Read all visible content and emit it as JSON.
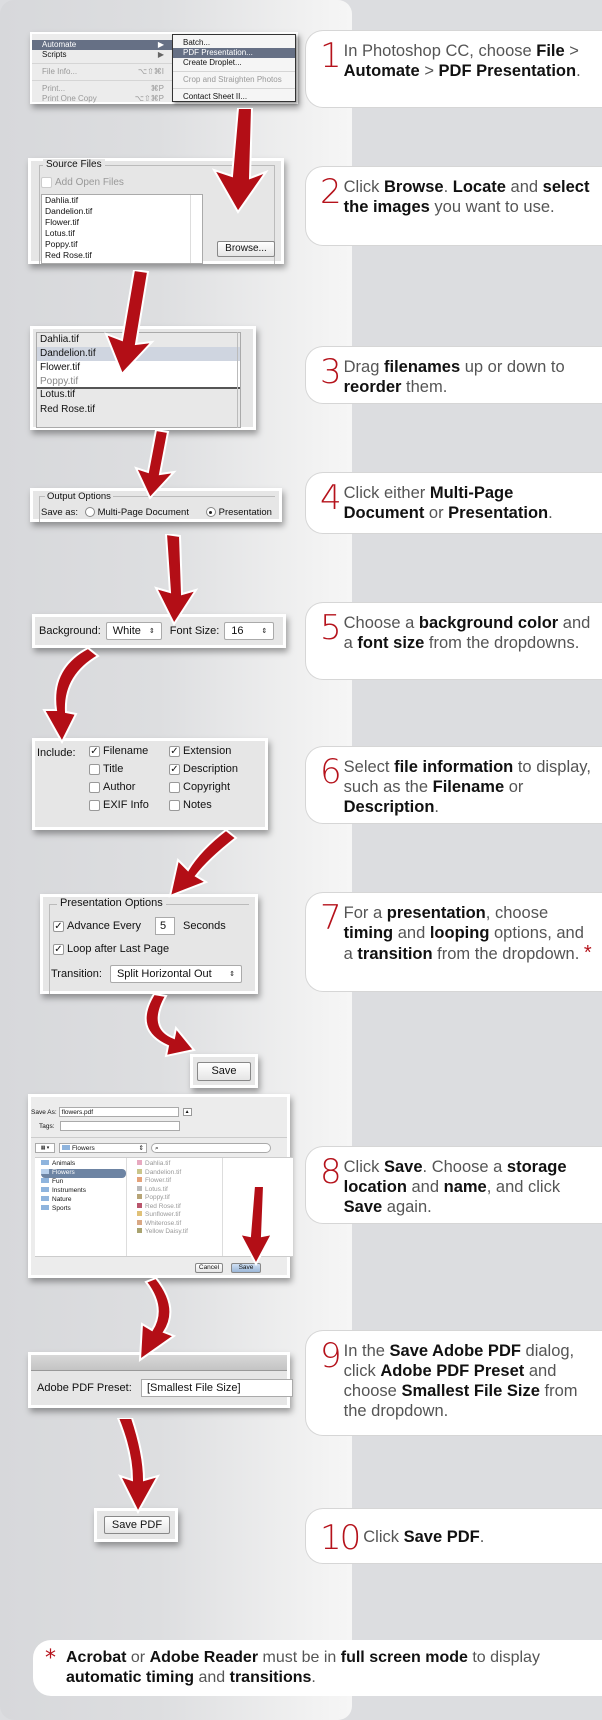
{
  "colors": {
    "accent": "#b5121b",
    "background": "#dcdde0",
    "card": "#ffffff",
    "menu_highlight": "#667085"
  },
  "steps": [
    {
      "num": "1",
      "parts": [
        [
          "In Photoshop CC, choose ",
          false
        ],
        [
          "File",
          true
        ],
        [
          " > ",
          false
        ],
        [
          "Automate",
          true
        ],
        [
          " > ",
          false
        ],
        [
          "PDF Presentation",
          true
        ],
        [
          ".",
          false
        ]
      ]
    },
    {
      "num": "2",
      "parts": [
        [
          "Click ",
          false
        ],
        [
          "Browse",
          true
        ],
        [
          ". ",
          false
        ],
        [
          "Locate",
          true
        ],
        [
          " and ",
          false
        ],
        [
          "select the images",
          true
        ],
        [
          " you want to use.",
          false
        ]
      ]
    },
    {
      "num": "3",
      "parts": [
        [
          "Drag ",
          false
        ],
        [
          "filenames",
          true
        ],
        [
          " up or down to ",
          false
        ],
        [
          "reorder",
          true
        ],
        [
          " them.",
          false
        ]
      ]
    },
    {
      "num": "4",
      "parts": [
        [
          "Click either ",
          false
        ],
        [
          "Multi-Page Document",
          true
        ],
        [
          " or ",
          false
        ],
        [
          "Presentation",
          true
        ],
        [
          ".",
          false
        ]
      ]
    },
    {
      "num": "5",
      "parts": [
        [
          "Choose a ",
          false
        ],
        [
          "background color",
          true
        ],
        [
          " and a ",
          false
        ],
        [
          "font size",
          true
        ],
        [
          " from the dropdowns.",
          false
        ]
      ]
    },
    {
      "num": "6",
      "parts": [
        [
          "Select ",
          false
        ],
        [
          "file information",
          true
        ],
        [
          " to display, such as the ",
          false
        ],
        [
          "Filename",
          true
        ],
        [
          " or ",
          false
        ],
        [
          "Description",
          true
        ],
        [
          ".",
          false
        ]
      ]
    },
    {
      "num": "7",
      "parts": [
        [
          "For a ",
          false
        ],
        [
          "presentation",
          true
        ],
        [
          ", choose ",
          false
        ],
        [
          "timing",
          true
        ],
        [
          " and ",
          false
        ],
        [
          "looping",
          true
        ],
        [
          " options, and a ",
          false
        ],
        [
          "transition",
          true
        ],
        [
          " from the dropdown. ",
          false
        ]
      ],
      "asterisk": "*"
    },
    {
      "num": "8",
      "parts": [
        [
          "Click ",
          false
        ],
        [
          "Save",
          true
        ],
        [
          ". Choose a ",
          false
        ],
        [
          "storage location",
          true
        ],
        [
          " and ",
          false
        ],
        [
          "name",
          true
        ],
        [
          ", and click ",
          false
        ],
        [
          "Save",
          true
        ],
        [
          " again.",
          false
        ]
      ]
    },
    {
      "num": "9",
      "parts": [
        [
          "In the ",
          false
        ],
        [
          "Save Adobe PDF",
          true
        ],
        [
          " dialog, click ",
          false
        ],
        [
          "Adobe PDF Preset",
          true
        ],
        [
          " and choose ",
          false
        ],
        [
          "Smallest File Size",
          true
        ],
        [
          " from the dropdown.",
          false
        ]
      ]
    },
    {
      "num": "10",
      "parts": [
        [
          "Click ",
          false
        ],
        [
          "Save PDF",
          true
        ],
        [
          ".",
          false
        ]
      ]
    }
  ],
  "menu": {
    "main": [
      {
        "label": "Automate",
        "shortcut": "▶",
        "state": "selected"
      },
      {
        "label": "Scripts",
        "shortcut": "▶",
        "state": "normal"
      },
      {
        "label": "File Info...",
        "shortcut": "⌥⇧⌘I",
        "state": "disabled"
      },
      {
        "label": "Print...",
        "shortcut": "⌘P",
        "state": "disabled"
      },
      {
        "label": "Print One Copy",
        "shortcut": "⌥⇧⌘P",
        "state": "disabled"
      }
    ],
    "submenu": [
      {
        "label": "Batch...",
        "state": "normal"
      },
      {
        "label": "PDF Presentation...",
        "state": "selected"
      },
      {
        "label": "Create Droplet...",
        "state": "normal"
      },
      {
        "label": "Crop and Straighten Photos",
        "state": "disabled"
      },
      {
        "label": "Contact Sheet II...",
        "state": "normal"
      }
    ]
  },
  "source_files": {
    "legend": "Source Files",
    "add_open_files": "Add Open Files",
    "files": [
      "Dahlia.tif",
      "Dandelion.tif",
      "Flower.tif",
      "Lotus.tif",
      "Poppy.tif",
      "Red Rose.tif"
    ],
    "browse_label": "Browse..."
  },
  "reorder": {
    "files": [
      "Dahlia.tif",
      "Dandelion.tif",
      "Flower.tif",
      "Poppy.tif",
      "Lotus.tif",
      "Red Rose.tif"
    ],
    "dragging": "Dandelion.tif"
  },
  "output_options": {
    "legend": "Output Options",
    "save_as_label": "Save as:",
    "option_multi": "Multi-Page Document",
    "option_presentation": "Presentation",
    "selected": "Presentation"
  },
  "background_font": {
    "background_label": "Background:",
    "background_value": "White",
    "font_size_label": "Font Size:",
    "font_size_value": "16"
  },
  "include": {
    "label": "Include:",
    "options": [
      {
        "label": "Filename",
        "checked": true
      },
      {
        "label": "Extension",
        "checked": true
      },
      {
        "label": "Title",
        "checked": false
      },
      {
        "label": "Description",
        "checked": true
      },
      {
        "label": "Author",
        "checked": false
      },
      {
        "label": "Copyright",
        "checked": false
      },
      {
        "label": "EXIF Info",
        "checked": false
      },
      {
        "label": "Notes",
        "checked": false
      }
    ]
  },
  "presentation_options": {
    "legend": "Presentation Options",
    "advance_label": "Advance Every",
    "advance_checked": true,
    "advance_value": "5",
    "seconds_label": "Seconds",
    "loop_label": "Loop after Last Page",
    "loop_checked": true,
    "transition_label": "Transition:",
    "transition_value": "Split Horizontal Out"
  },
  "save_button_label": "Save",
  "save_dialog": {
    "save_as_label": "Save As:",
    "save_as_value": "flowers.pdf",
    "tags_label": "Tags:",
    "location": "Flowers",
    "folders": [
      "Animals",
      "Flowers",
      "Fun",
      "Instruments",
      "Nature",
      "Sports"
    ],
    "selected_folder": "Flowers",
    "files": [
      "Dahlia.tif",
      "Dandelion.tif",
      "Flower.tif",
      "Lotus.tif",
      "Poppy.tif",
      "Red Rose.tif",
      "Sunflower.tif",
      "Whiterose.tif",
      "Yellow Daisy.tif"
    ],
    "cancel_label": "Cancel",
    "save_label": "Save"
  },
  "pdf_preset": {
    "label": "Adobe PDF Preset:",
    "value": "[Smallest File Size]"
  },
  "save_pdf_label": "Save PDF",
  "footnote": {
    "star": "*",
    "parts": [
      [
        "Acrobat",
        true
      ],
      [
        " or ",
        false
      ],
      [
        "Adobe Reader",
        true
      ],
      [
        " must be in ",
        false
      ],
      [
        "full screen mode",
        true
      ],
      [
        " to display ",
        false
      ],
      [
        "automatic timing",
        true
      ],
      [
        " and ",
        false
      ],
      [
        "transitions",
        true
      ],
      [
        ".",
        false
      ]
    ]
  }
}
